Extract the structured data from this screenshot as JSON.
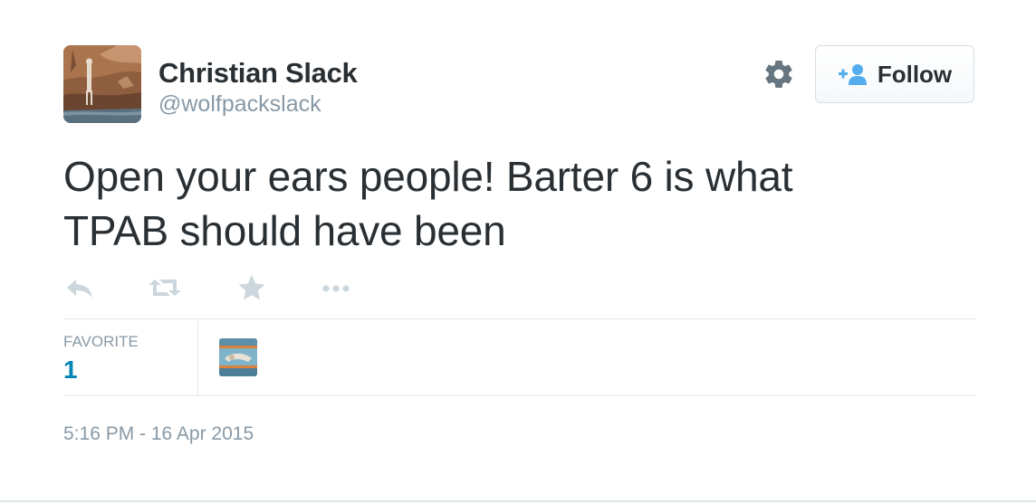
{
  "author": {
    "fullname": "Christian Slack",
    "username": "@wolfpackslack"
  },
  "follow_button": {
    "label": "Follow",
    "icon": "follow-person-plus-icon"
  },
  "settings": {
    "icon": "gear-icon"
  },
  "tweet": {
    "text_line1": "Open your ears people! Barter 6 is what",
    "text_line2": "TPAB should have been"
  },
  "actions": [
    {
      "name": "reply",
      "icon": "reply-icon"
    },
    {
      "name": "retweet",
      "icon": "retweet-icon"
    },
    {
      "name": "favorite",
      "icon": "star-icon"
    },
    {
      "name": "more",
      "icon": "more-dots-icon"
    }
  ],
  "stats": {
    "label": "FAVORITE",
    "count": "1"
  },
  "timestamp": "5:16 PM - 16 Apr 2015",
  "colors": {
    "text": "#292f33",
    "secondary": "#8899a6",
    "link": "#0084b4",
    "follow_icon": "#55acee",
    "action_icon": "#ccd6dd",
    "divider": "#e1e8ed"
  }
}
